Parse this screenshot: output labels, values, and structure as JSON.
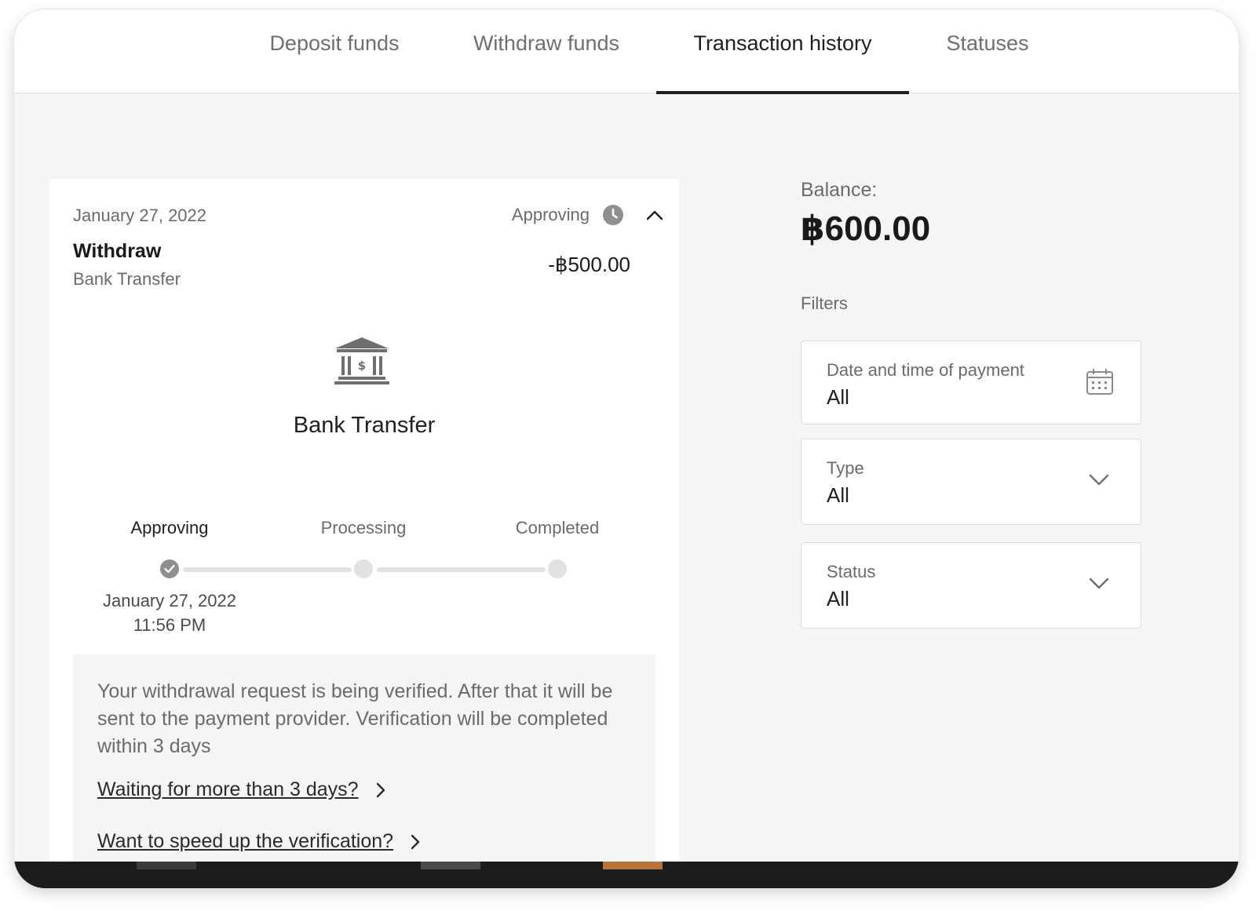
{
  "tabs": [
    {
      "label": "Deposit funds",
      "active": false
    },
    {
      "label": "Withdraw funds",
      "active": false
    },
    {
      "label": "Transaction history",
      "active": true
    },
    {
      "label": "Statuses",
      "active": false
    }
  ],
  "transaction": {
    "date": "January 27, 2022",
    "status": "Approving",
    "type": "Withdraw",
    "method": "Bank Transfer",
    "amount": "-฿500.00",
    "method_title": "Bank Transfer",
    "icon": "bank-icon",
    "steps": [
      {
        "label": "Approving",
        "state": "done"
      },
      {
        "label": "Processing",
        "state": "pending"
      },
      {
        "label": "Completed",
        "state": "pending"
      }
    ],
    "step_date": "January 27, 2022",
    "step_time": "11:56 PM",
    "info_text": "Your withdrawal request is being verified. After that it will be sent to the payment provider. Verification will be completed within 3 days",
    "links": [
      {
        "label": "Waiting for more than 3 days?"
      },
      {
        "label": "Want to speed up the verification?"
      }
    ]
  },
  "balance": {
    "label": "Balance:",
    "value": "฿600.00"
  },
  "filters": {
    "label": "Filters",
    "items": [
      {
        "label": "Date and time of payment",
        "value": "All",
        "icon": "calendar-icon"
      },
      {
        "label": "Type",
        "value": "All",
        "icon": "chevron-down-icon"
      },
      {
        "label": "Status",
        "value": "All",
        "icon": "chevron-down-icon"
      }
    ]
  },
  "colors": {
    "background": "#f4f5f5",
    "card": "#ffffff",
    "text_primary": "#1f1f1f",
    "text_secondary": "#6b6b6b",
    "active_tab_underline": "#1f1f1f",
    "bottom_strip_accent": "#b8733a"
  }
}
